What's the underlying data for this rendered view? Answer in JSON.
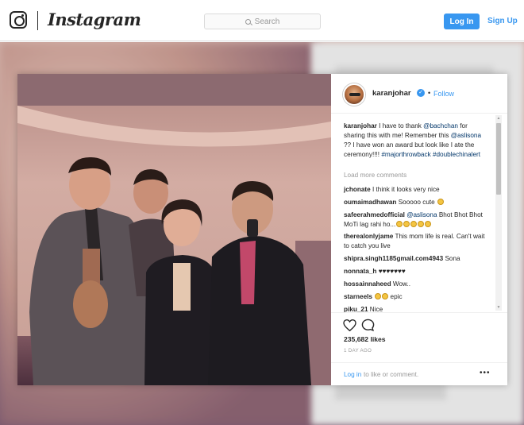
{
  "nav": {
    "wordmark": "Instagram",
    "search_placeholder": "Search",
    "login_label": "Log In",
    "signup_label": "Sign Up"
  },
  "post": {
    "username": "karanjohar",
    "verified_mark": "✓",
    "separator": "•",
    "follow_label": "Follow",
    "caption": {
      "user": "karanjohar",
      "t1": " I have to thank ",
      "m1": "@bachchan",
      "t2": " for sharing this with me! Remember this ",
      "m2": "@aslisona",
      "t3": " ?? I have won an award but look like I ate the ceremony!!!! ",
      "h1": "#majorthrowback",
      "t4": " ",
      "h2": "#doublechinalert"
    },
    "load_more": "Load more comments",
    "comments": [
      {
        "user": "jchonate",
        "text": "I think it looks very nice"
      },
      {
        "user": "oumaimadhawan",
        "text": "Sooooo cute"
      },
      {
        "user": "safeerahmedofficial",
        "mention": "@aslisona",
        "text": " Bhot Bhot Bhot MoTi lag rahi ho..."
      },
      {
        "user": "therealonlyjame",
        "text": "This mom life is real. Can't wait to catch you live"
      },
      {
        "user": "shipra.singh1185gmail.com4943",
        "text": "Sona"
      },
      {
        "user": "nonnata_h",
        "text": "♥♥♥♥♥♥♥"
      },
      {
        "user": "hossainnaheed",
        "text": "Wow.."
      },
      {
        "user": "starneels",
        "text": "epic"
      },
      {
        "user": "piku_21",
        "text": "Nice"
      }
    ],
    "likes": "235,682 likes",
    "time_ago": "1 DAY AGO",
    "login_link": "Log in",
    "login_rest": "to like or comment.",
    "more_glyph": "•••"
  },
  "colors": {
    "accent": "#3897f0",
    "link": "#003569"
  }
}
